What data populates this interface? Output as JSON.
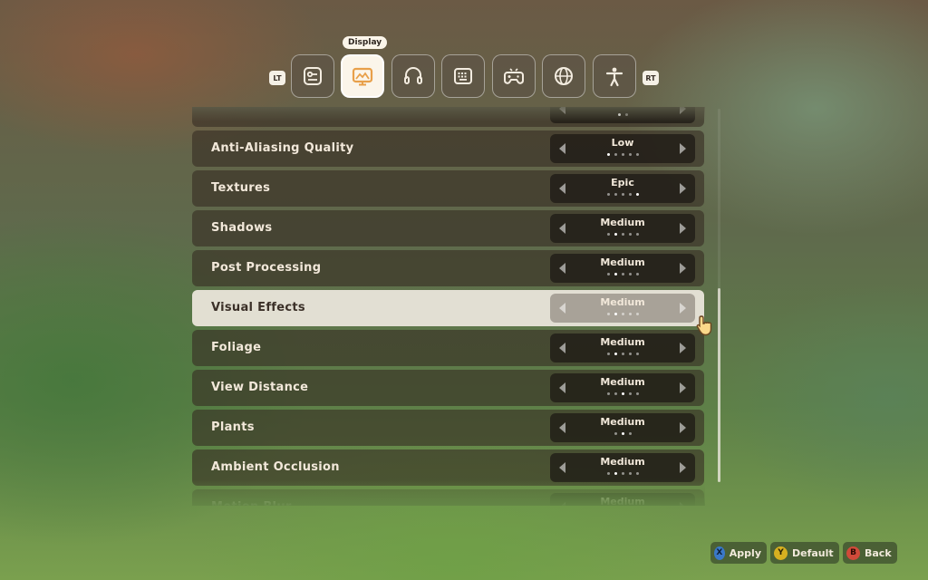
{
  "tabs": {
    "left_bumper": "LT",
    "right_bumper": "RT",
    "active_tooltip": "Display",
    "items": [
      {
        "icon": "general-settings-icon"
      },
      {
        "icon": "display-monitor-icon"
      },
      {
        "icon": "headphones-audio-icon"
      },
      {
        "icon": "keyboard-icon"
      },
      {
        "icon": "gamepad-icon"
      },
      {
        "icon": "globe-language-icon"
      },
      {
        "icon": "accessibility-person-icon"
      }
    ]
  },
  "settings": [
    {
      "label": "",
      "value": "",
      "level": 0,
      "steps": 2,
      "partial": "top"
    },
    {
      "label": "Anti-Aliasing Quality",
      "value": "Low",
      "level": 0,
      "steps": 5
    },
    {
      "label": "Textures",
      "value": "Epic",
      "level": 4,
      "steps": 5
    },
    {
      "label": "Shadows",
      "value": "Medium",
      "level": 1,
      "steps": 5
    },
    {
      "label": "Post Processing",
      "value": "Medium",
      "level": 1,
      "steps": 5
    },
    {
      "label": "Visual Effects",
      "value": "Medium",
      "level": 1,
      "steps": 5,
      "selected": true
    },
    {
      "label": "Foliage",
      "value": "Medium",
      "level": 1,
      "steps": 5
    },
    {
      "label": "View Distance",
      "value": "Medium",
      "level": 2,
      "steps": 5
    },
    {
      "label": "Plants",
      "value": "Medium",
      "level": 1,
      "steps": 3
    },
    {
      "label": "Ambient Occlusion",
      "value": "Medium",
      "level": 1,
      "steps": 5
    },
    {
      "label": "Motion Blur",
      "value": "Medium",
      "level": 1,
      "steps": 5,
      "partial": "bottom"
    }
  ],
  "footer": {
    "apply": {
      "button": "X",
      "label": "Apply"
    },
    "default": {
      "button": "Y",
      "label": "Default"
    },
    "back": {
      "button": "B",
      "label": "Back"
    }
  },
  "colors": {
    "active_tab": "#fbf5ea",
    "row_bg": "#3a2f25",
    "selected_row": "#eee8de",
    "x_button": "#3a78c8",
    "y_button": "#d8b020",
    "b_button": "#d04a3a"
  }
}
